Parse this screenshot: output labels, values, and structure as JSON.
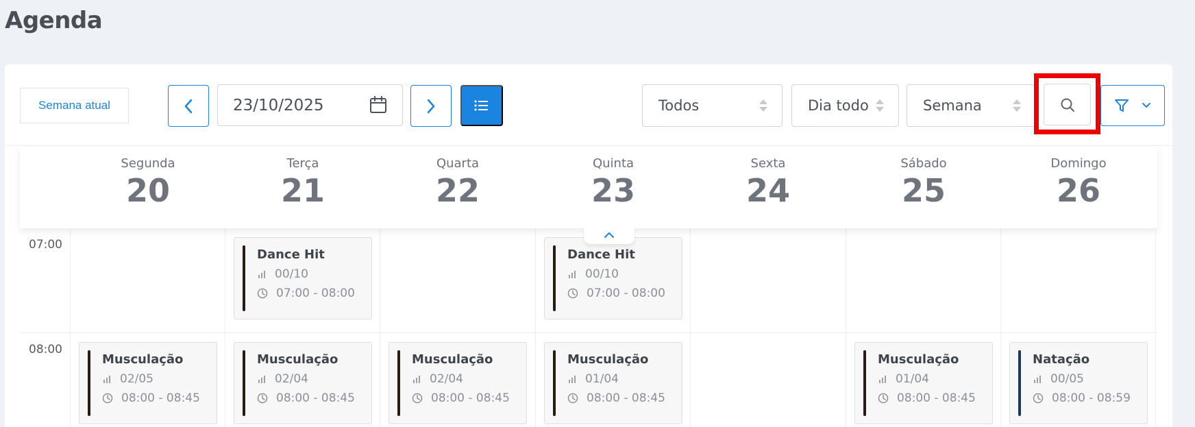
{
  "page": {
    "title": "Agenda"
  },
  "toolbar": {
    "current_week_label": "Semana atual",
    "date_value": "23/10/2025",
    "filter_todos": "Todos",
    "filter_period": "Dia todo",
    "filter_view": "Semana"
  },
  "colors": {
    "accent": "#1a85e0",
    "highlight": "#ef0000",
    "event_bar_default": "#2b1a12",
    "event_bar_natacao": "#173a63"
  },
  "icons": [
    "chevron-left-icon",
    "calendar-icon",
    "chevron-right-icon",
    "list-icon",
    "sort-icon",
    "search-icon",
    "filter-icon",
    "chevron-down-icon",
    "chevron-up-icon",
    "bar-chart-icon",
    "clock-icon"
  ],
  "days": [
    {
      "name": "Segunda",
      "num": "20"
    },
    {
      "name": "Terça",
      "num": "21"
    },
    {
      "name": "Quarta",
      "num": "22"
    },
    {
      "name": "Quinta",
      "num": "23"
    },
    {
      "name": "Sexta",
      "num": "24"
    },
    {
      "name": "Sábado",
      "num": "25"
    },
    {
      "name": "Domingo",
      "num": "26"
    }
  ],
  "times": [
    "07:00",
    "08:00"
  ],
  "events": [
    {
      "day": 1,
      "slot": 0,
      "name": "Dance Hit",
      "capacity": "00/10",
      "time": "07:00 - 08:00",
      "color": "#2b1a12"
    },
    {
      "day": 3,
      "slot": 0,
      "name": "Dance Hit",
      "capacity": "00/10",
      "time": "07:00 - 08:00",
      "color": "#2b1a12"
    },
    {
      "day": 0,
      "slot": 1,
      "name": "Musculação",
      "capacity": "02/05",
      "time": "08:00 - 08:45",
      "color": "#2b1a12"
    },
    {
      "day": 1,
      "slot": 1,
      "name": "Musculação",
      "capacity": "02/04",
      "time": "08:00 - 08:45",
      "color": "#2b1a12"
    },
    {
      "day": 2,
      "slot": 1,
      "name": "Musculação",
      "capacity": "02/04",
      "time": "08:00 - 08:45",
      "color": "#2b1a12"
    },
    {
      "day": 3,
      "slot": 1,
      "name": "Musculação",
      "capacity": "01/04",
      "time": "08:00 - 08:45",
      "color": "#2b1a12"
    },
    {
      "day": 5,
      "slot": 1,
      "name": "Musculação",
      "capacity": "01/04",
      "time": "08:00 - 08:45",
      "color": "#2b1a12"
    },
    {
      "day": 6,
      "slot": 1,
      "name": "Natação",
      "capacity": "00/05",
      "time": "08:00 - 08:59",
      "color": "#173a63"
    }
  ]
}
